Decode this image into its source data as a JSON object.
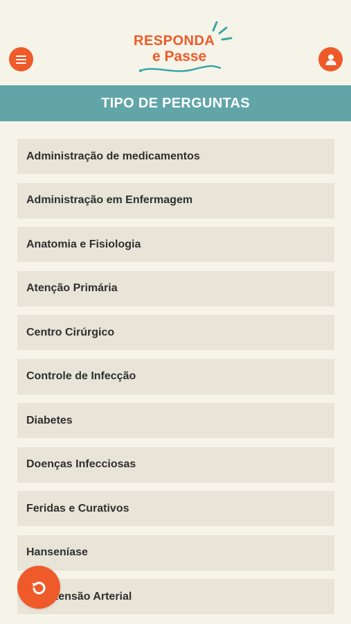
{
  "header": {
    "logo_line1": "RESPONDA",
    "logo_line2": "e Passe",
    "menu_icon": "hamburger-menu-icon",
    "profile_icon": "user-icon"
  },
  "title_bar": {
    "title": "TIPO DE PERGUNTAS"
  },
  "categories": [
    "Administração de medicamentos",
    "Administração em Enfermagem",
    "Anatomia e Fisiologia",
    "Atenção Primária",
    "Centro Cirúrgico",
    "Controle de Infecção",
    "Diabetes",
    "Doenças Infecciosas",
    "Feridas e Curativos",
    "Hanseníase",
    "Hipertensão Arterial"
  ],
  "fab": {
    "icon": "undo-icon"
  },
  "colors": {
    "accent": "#ef5a2a",
    "title_bar": "#62a5a9",
    "background": "#f6f4e8",
    "item_bg": "#e8e4d7"
  }
}
